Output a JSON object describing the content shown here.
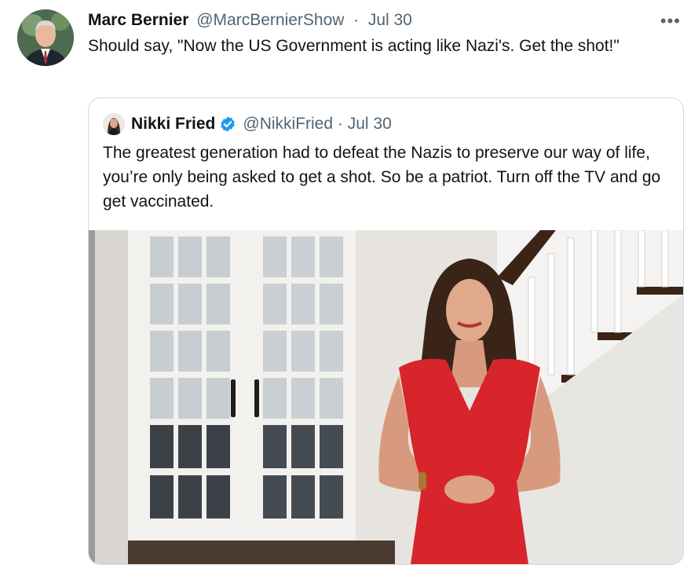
{
  "tweet": {
    "author_name": "Marc Bernier",
    "author_handle": "@MarcBernierShow",
    "separator": "·",
    "date": "Jul 30",
    "more_label": "•••",
    "text": "Should say, \"Now the US Government is acting like Nazi's. Get the shot!\""
  },
  "quote": {
    "author_name": "Nikki Fried",
    "author_handle": "@NikkiFried",
    "separator": "·",
    "date": "Jul 30",
    "verified": true,
    "text": "The greatest generation had to defeat the Nazis to preserve our way of life, you’re only being asked to get a shot. So be a patriot. Turn off the TV and go get vaccinated."
  },
  "icons": {
    "more": "more-icon",
    "verified": "verified-badge-icon"
  },
  "colors": {
    "text_primary": "#0f1419",
    "text_secondary": "#536471",
    "border": "#cfd9de",
    "verified_blue": "#1d9bf0",
    "dress_red": "#d8242b"
  }
}
